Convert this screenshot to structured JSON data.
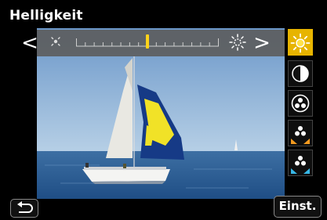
{
  "screen": {
    "title": "Helligkeit"
  },
  "slider": {
    "level": 0.5,
    "ticks": 17
  },
  "side_menu": [
    {
      "name": "brightness",
      "icon": "sun-icon",
      "active": true
    },
    {
      "name": "contrast",
      "icon": "contrast-icon",
      "active": false
    },
    {
      "name": "saturation",
      "icon": "saturation-icon",
      "active": false
    },
    {
      "name": "color-tone-warm",
      "icon": "color-tone-warm-icon",
      "active": false
    },
    {
      "name": "color-tone-cool",
      "icon": "color-tone-cool-icon",
      "active": false
    }
  ],
  "footer": {
    "set_label": "Einst."
  },
  "colors": {
    "accent": "#e7b400",
    "marker": "#ffd31a",
    "strip": "#5c5c5c"
  }
}
